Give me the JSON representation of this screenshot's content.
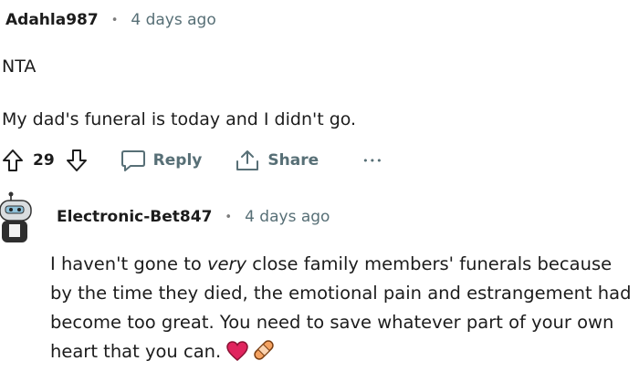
{
  "comment": {
    "username": "Adahla987",
    "separator": "•",
    "timestamp": "4 days ago",
    "line1": "NTA",
    "line2": "My dad's funeral is today and I didn't go.",
    "upvotes": "29",
    "reply_label": "Reply",
    "share_label": "Share",
    "more_label": "•••"
  },
  "reply": {
    "username": "Electronic-Bet847",
    "separator": "•",
    "timestamp": "4 days ago",
    "text_part1": "I haven't gone to ",
    "text_emphasis": "very",
    "text_part2": " close family members' funerals because by the time they died, the emotional pain and estrangement had become too great. You need to save whatever part of your own heart that you can. ",
    "emoji": [
      "red-heart",
      "adhesive-bandage"
    ]
  },
  "colors": {
    "text": "#1c1c1c",
    "meta": "#576f76",
    "heart": "#e0245e",
    "bandage": "#f4a261"
  }
}
